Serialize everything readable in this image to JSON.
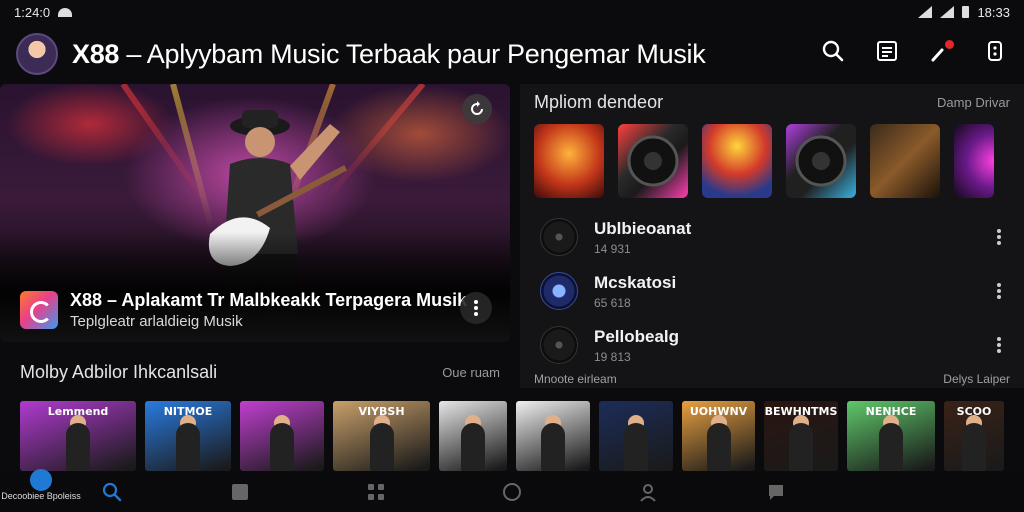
{
  "status_bar": {
    "time": "1:24:0",
    "clock_right": "18:33"
  },
  "header": {
    "title_brand": "X88",
    "title_rest": "– Aplyybam Music Terbaak paur Pengemar Musik"
  },
  "hero": {
    "title": "X88 – Aplakamt Tr Malbkeakk Terpagera Musik",
    "subtitle": "Teplgleatr arlaldieig Musik"
  },
  "right_panel": {
    "title": "Mpliom dendeor",
    "link": "Damp Drivar",
    "tracks": [
      {
        "name": "Ublbieoanat",
        "meta": "14 931"
      },
      {
        "name": "Mcskatosi",
        "meta": "65 618"
      },
      {
        "name": "Pellobealg",
        "meta": "19 813"
      }
    ],
    "footer_left": "Mnoote eirleam",
    "footer_right": "Delys Laiper"
  },
  "bottom_section": {
    "title": "Molby Adbilor Ihkcanlsali",
    "link": "Oue ruam",
    "covers": [
      {
        "label": "Lemmend",
        "color": "#b03bd0"
      },
      {
        "label": "NITMOE",
        "color": "#2a7be0"
      },
      {
        "label": "",
        "color": "#c13fd1"
      },
      {
        "label": "VIYBSH",
        "color": "#c9a06a"
      },
      {
        "label": "",
        "color": "#e6e6e6"
      },
      {
        "label": "",
        "color": "#f0f0f0"
      },
      {
        "label": "",
        "color": "#1c2d5a"
      },
      {
        "label": "UOHWNV",
        "color": "#e8a040"
      },
      {
        "label": "BEWHNTMS",
        "color": "#2a1510"
      },
      {
        "label": "NENHCE",
        "color": "#5fc86a"
      },
      {
        "label": "SCOO",
        "color": "#3a2218"
      }
    ]
  },
  "nav": {
    "home_label": "Decoobiee Bpoleiss"
  },
  "colors": {
    "accent": "#1f7ad6",
    "record_dot": "#e6262d"
  }
}
